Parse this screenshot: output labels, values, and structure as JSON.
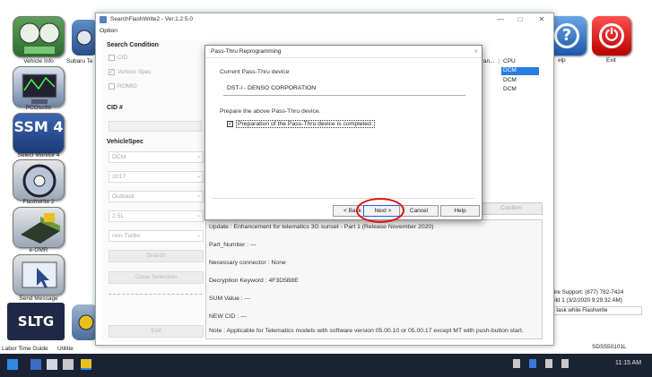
{
  "launcher": {
    "left_items": [
      {
        "label": "Vehicle Info",
        "icon": "gauges-icon"
      },
      {
        "label": "PCOscillo",
        "icon": "oscilloscope-icon"
      },
      {
        "label": "Select Monitor 4",
        "icon": "ssm-logo-icon",
        "icon_text": "SSM 4"
      },
      {
        "label": "Flashwrite 2",
        "icon": "flash-disc-icon"
      },
      {
        "label": "e-GMR",
        "icon": "ecu-module-icon"
      },
      {
        "label": "Send Message",
        "icon": "send-cursor-icon"
      },
      {
        "label": "Labor Time Guide",
        "icon": "sltg-logo-icon",
        "icon_text": "SLTG"
      }
    ],
    "second_column_label": "Subaru Te",
    "second_column_bottom_label": "Utilitie",
    "right_items": [
      {
        "label": "elp",
        "icon": "question-icon"
      },
      {
        "label": "Exit",
        "icon": "power-icon"
      }
    ],
    "support_lines": [
      "Inspire Support: (877) 782-7424",
      "5 build 1 (3/2/2020 9:29:32 AM)"
    ],
    "support_notice": "this task while Flashwrite",
    "version_code": "SDS550101L"
  },
  "window": {
    "title": "SearchFlashWrite2 - Ver.1.2.5.0",
    "menu": "Option",
    "controls": {
      "minimize": "—",
      "maximize": "□",
      "close": "✕"
    },
    "search_condition": {
      "heading": "Search Condition",
      "options": [
        {
          "label": "CID",
          "checked": false
        },
        {
          "label": "Vehicle Spec",
          "checked": true
        },
        {
          "label": "ROMID",
          "checked": false
        }
      ]
    },
    "cid_label": "CID #",
    "vehicle_spec": {
      "heading": "VehicleSpec",
      "fields": [
        "DCM",
        "2017",
        "Outback",
        "2.5L",
        "non-Turbo"
      ]
    },
    "buttons": {
      "search": "Search",
      "clear": "Clear Selection",
      "exit": "Exit",
      "confirm": "Confirm"
    },
    "results_header": {
      "col1": "Tran...",
      "col2": "CPU",
      "rows": [
        "DCM",
        "DCM",
        "DCM"
      ],
      "left_letter": "S"
    },
    "details": {
      "title_prefix": "D",
      "lines": [
        "Update : Enhancement for telematics 3G sunset - Part 1 (Release November 2020)",
        "Part_Number : ---",
        "Necessary connector : None",
        "Decryption Keyword : 4F3D5B8E",
        "SUM Value : ---",
        "NEW CID : ---",
        "Note : Applicable for Telematics models with software version 05.00.10 or 05.00.17 except MT with push-button start."
      ]
    }
  },
  "dialog": {
    "title": "Pass-Thru Reprogramming",
    "close_glyph": "×",
    "current_device_label": "Current Pass-Thru device",
    "current_device_value": "DST-i - DENSO CORPORATION",
    "prepare_text": "Prepare the above Pass-Thru device.",
    "checkbox_label": "Preparation of the Pass-Thru device is completed.",
    "checkbox_checked": true,
    "buttons": {
      "back": "< Back",
      "next": "Next >",
      "cancel": "Cancel",
      "help": "Help"
    }
  },
  "taskbar": {
    "time": "11:15 AM",
    "accent": "#2d8be6"
  }
}
